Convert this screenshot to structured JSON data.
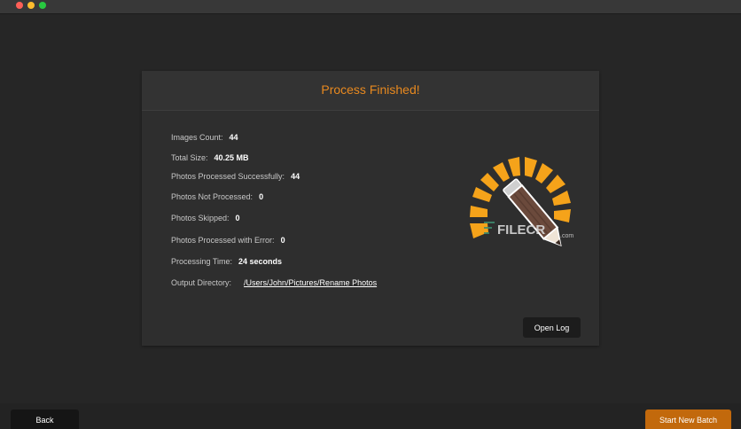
{
  "panel": {
    "title": "Process Finished!"
  },
  "stats": {
    "images_count_label": "Images Count:",
    "images_count_value": "44",
    "total_size_label": "Total Size:",
    "total_size_value": "40.25 MB",
    "processed_ok_label": "Photos Processed Successfully:",
    "processed_ok_value": "44",
    "not_processed_label": "Photos Not Processed:",
    "not_processed_value": "0",
    "skipped_label": "Photos Skipped:",
    "skipped_value": "0",
    "with_error_label": "Photos Processed with Error:",
    "with_error_value": "0",
    "processing_time_label": "Processing Time:",
    "processing_time_value": "24 seconds",
    "output_dir_label": "Output Directory:",
    "output_dir_value": "/Users/John/Pictures/Rename Photos"
  },
  "watermark": {
    "text": "FILECR",
    "suffix": ".com"
  },
  "buttons": {
    "open_log": "Open Log",
    "back": "Back",
    "start_new_batch": "Start New Batch"
  },
  "colors": {
    "accent": "#e8891f",
    "primary_button": "#c2690c",
    "logo_orange": "#f5a31a",
    "pencil_brown": "#6b4a3c"
  },
  "icons": {
    "logo": "sunburst-pencil-icon"
  }
}
